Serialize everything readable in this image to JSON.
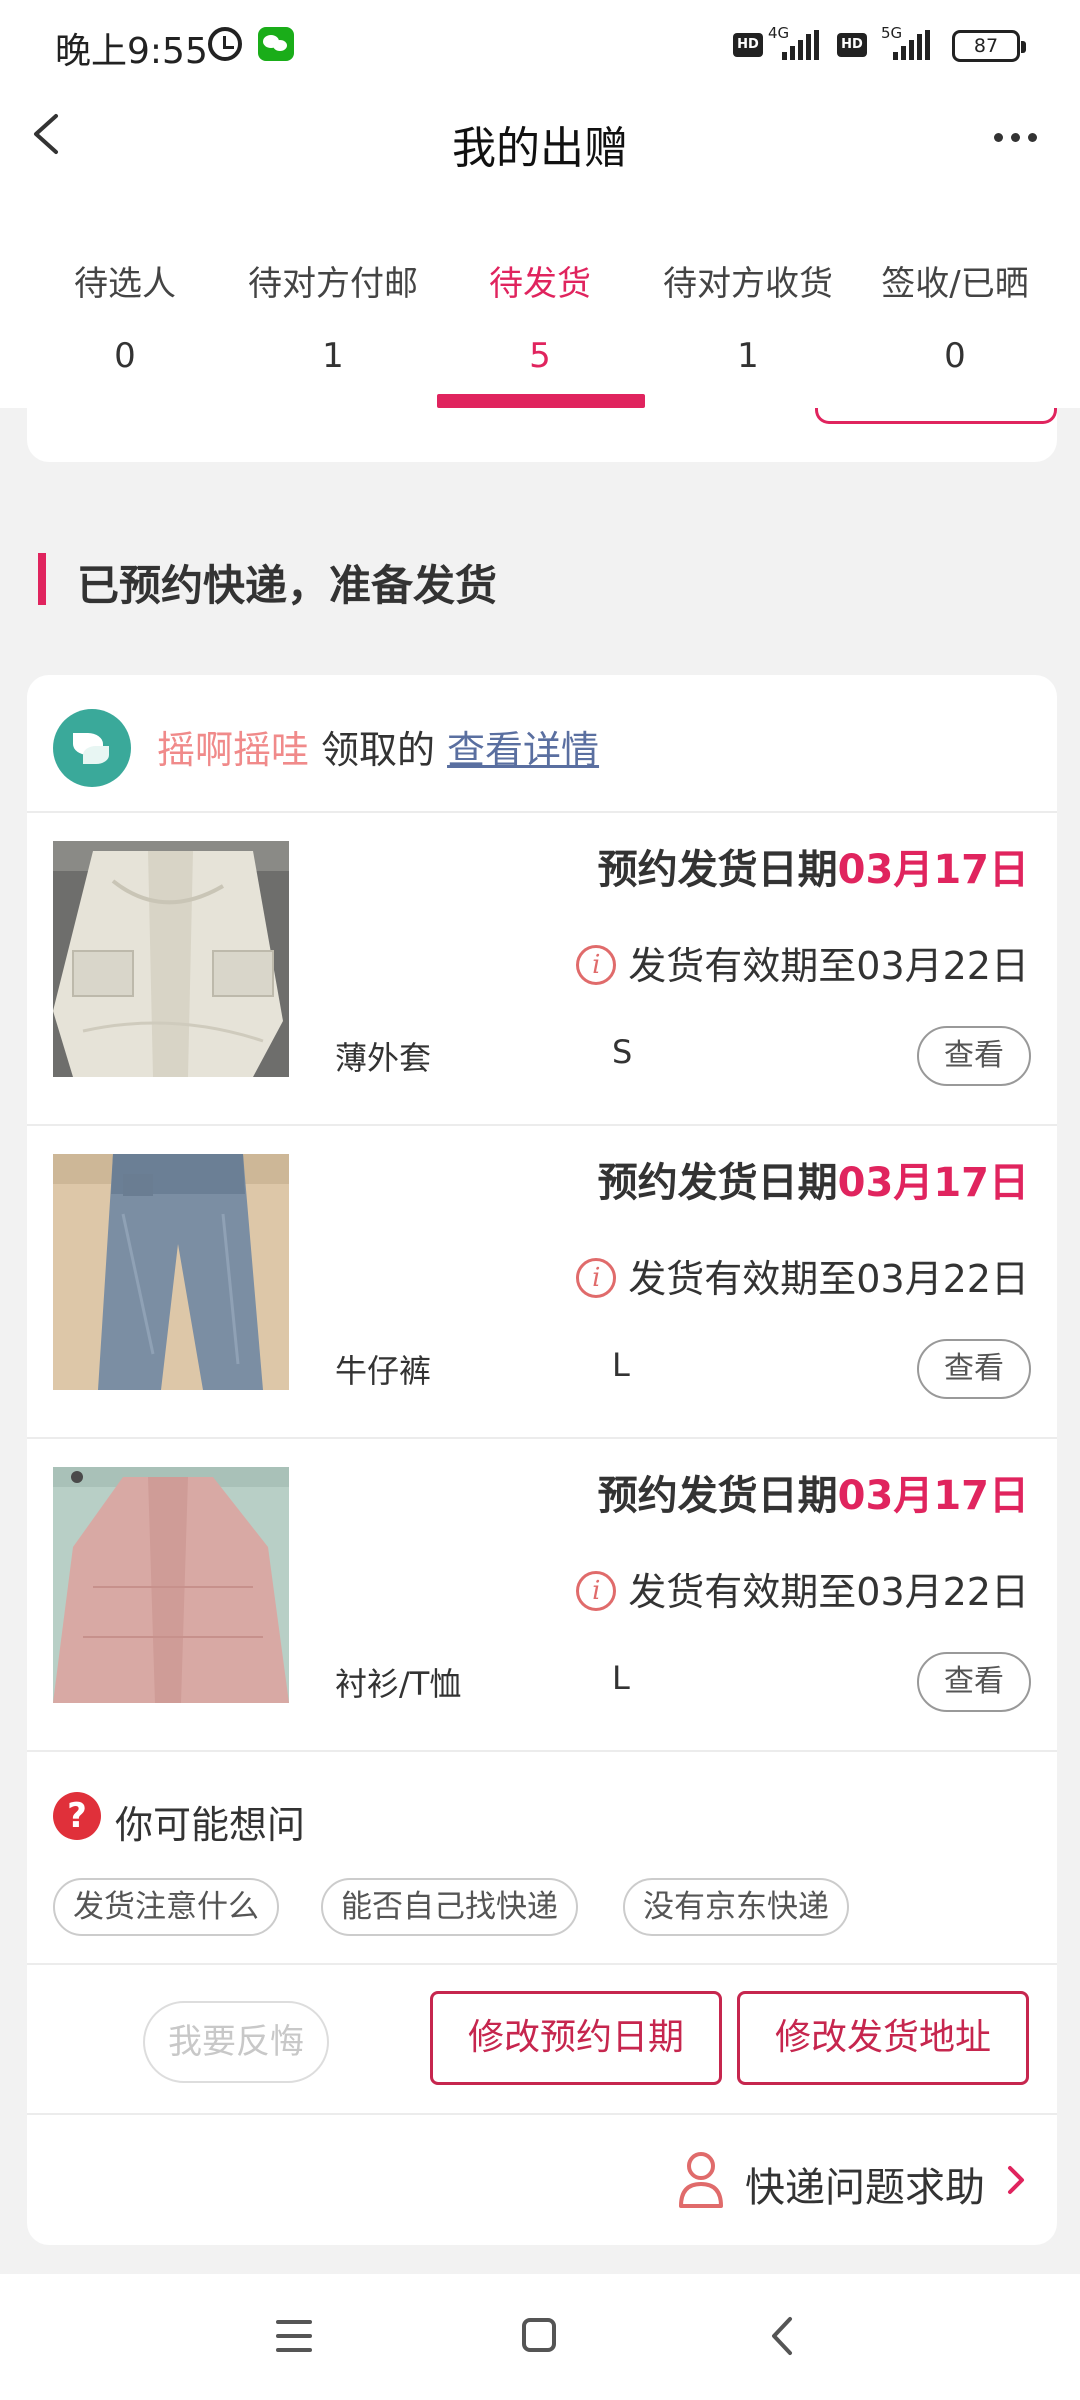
{
  "status_bar": {
    "time": "晚上9:55",
    "network_1": "4G",
    "network_2": "5G",
    "hd_badge": "HD",
    "battery": "87"
  },
  "header": {
    "title": "我的出赠",
    "back_icon": "back-chevron-icon",
    "more_icon": "more-dots-icon"
  },
  "tabs": [
    {
      "label": "待选人",
      "count": "0"
    },
    {
      "label": "待对方付邮",
      "count": "1"
    },
    {
      "label": "待发货",
      "count": "5",
      "active": true
    },
    {
      "label": "待对方收货",
      "count": "1"
    },
    {
      "label": "签收/已晒",
      "count": "0"
    }
  ],
  "section": {
    "title": "已预约快递，准备发货"
  },
  "order": {
    "donor_name": "摇啊摇哇",
    "donor_text": "领取的",
    "detail_link": "查看详情",
    "items": [
      {
        "name": "薄外套",
        "size": "S",
        "ship_label": "预约发货日期",
        "ship_date": "03月17日",
        "valid_text": "发货有效期至03月22日",
        "view_label": "查看"
      },
      {
        "name": "牛仔裤",
        "size": "L",
        "ship_label": "预约发货日期",
        "ship_date": "03月17日",
        "valid_text": "发货有效期至03月22日",
        "view_label": "查看"
      },
      {
        "name": "衬衫/T恤",
        "size": "L",
        "ship_label": "预约发货日期",
        "ship_date": "03月17日",
        "valid_text": "发货有效期至03月22日",
        "view_label": "查看"
      }
    ],
    "faq": {
      "title": "你可能想问",
      "chips": [
        "发货注意什么",
        "能否自己找快递",
        "没有京东快递"
      ]
    },
    "actions": {
      "regret": "我要反悔",
      "change_date": "修改预约日期",
      "change_address": "修改发货地址"
    },
    "help": {
      "label": "快递问题求助"
    }
  },
  "colors": {
    "accent": "#e0245e",
    "button_red": "#c6264e",
    "donor_name": "#f08a8a",
    "link": "#5a6fa0"
  }
}
